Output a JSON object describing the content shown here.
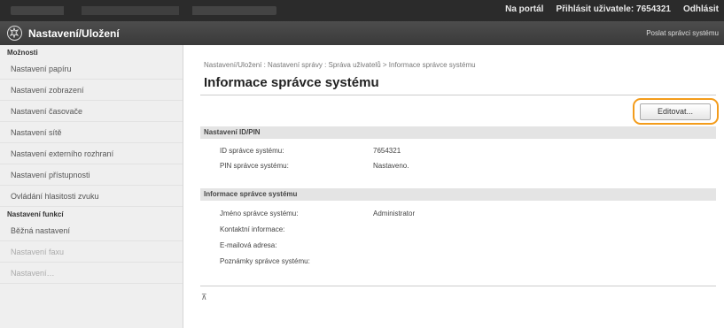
{
  "topbar": {
    "portal_link": "Na portál",
    "login_label": "Přihlásit uživatele:",
    "user_id": "7654321",
    "logout_link": "Odhlásit"
  },
  "titlebar": {
    "app_title": "Nastavení/Uložení",
    "mail_link": "Poslat správci systému"
  },
  "sidebar": {
    "section1_title": "Možnosti",
    "items1": [
      "Nastavení papíru",
      "Nastavení zobrazení",
      "Nastavení časovače",
      "Nastavení sítě",
      "Nastavení externího rozhraní",
      "Nastavení přístupnosti",
      "Ovládání hlasitosti zvuku"
    ],
    "section2_title": "Nastavení funkcí",
    "items2": [
      "Běžná nastavení",
      "Nastavení faxu",
      "Nastavení…"
    ]
  },
  "main": {
    "breadcrumb": "Nastavení/Uložení : Nastavení správy : Správa uživatelů > Informace správce systému",
    "title": "Informace správce systému",
    "edit_button": "Editovat...",
    "section1": {
      "title": "Nastavení ID/PIN",
      "rows": [
        {
          "label": "ID správce systému:",
          "value": "7654321"
        },
        {
          "label": "PIN správce systému:",
          "value": "Nastaveno."
        }
      ]
    },
    "section2": {
      "title": "Informace správce systému",
      "rows": [
        {
          "label": "Jméno správce systému:",
          "value": "Administrator"
        },
        {
          "label": "Kontaktní informace:",
          "value": ""
        },
        {
          "label": "E-mailová adresa:",
          "value": ""
        },
        {
          "label": "Poznámky správce systému:",
          "value": ""
        }
      ]
    },
    "top_link_icon": "⊼"
  },
  "colors": {
    "topbar_bg": "#2b2b2b",
    "titlebar_bg": "#444444",
    "highlight_orange": "#f39c1b",
    "section_bg": "#e4e4e4"
  },
  "icons": [
    "settings-logo-icon",
    "page-top-icon"
  ]
}
